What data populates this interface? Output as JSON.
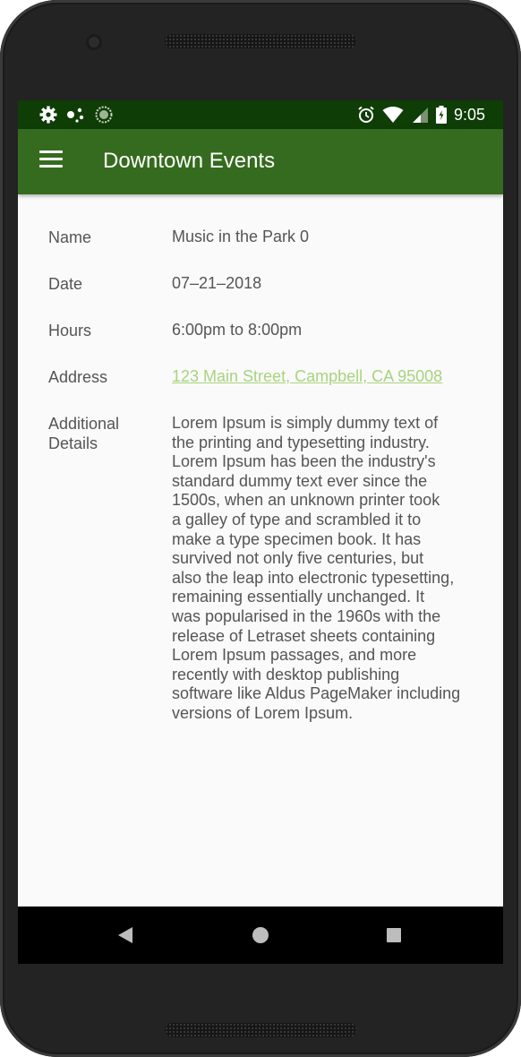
{
  "status_bar": {
    "time": "9:05",
    "icons": [
      "settings-icon",
      "notification-dots-icon",
      "sync-icon",
      "alarm-icon",
      "wifi-icon",
      "signal-icon",
      "battery-icon"
    ]
  },
  "app_bar": {
    "title": "Downtown Events",
    "menu_icon": "hamburger-menu-icon"
  },
  "details": {
    "name_label": "Name",
    "name_value": "Music in the Park 0",
    "date_label": "Date",
    "date_value": "07–21–2018",
    "hours_label": "Hours",
    "hours_value": "6:00pm to 8:00pm",
    "address_label": "Address",
    "address_value": "123 Main Street, Campbell, CA 95008",
    "additional_label_line1": "Additional",
    "additional_label_line2": "Details",
    "additional_lines": [
      "Lorem Ipsum is simply dummy text of",
      "the printing and typesetting industry.",
      "Lorem Ipsum has been the industry's",
      "standard dummy text ever since the",
      "1500s, when an unknown printer took",
      "a galley of type and scrambled it to",
      "make a type specimen book. It has",
      "survived not only five centuries, but",
      "also the leap into electronic typesetting,",
      "remaining essentially unchanged. It",
      "was popularised in the 1960s with the",
      "release of Letraset sheets containing",
      "Lorem Ipsum passages, and more",
      "recently with desktop publishing",
      "software like Aldus PageMaker including",
      "versions of Lorem Ipsum."
    ]
  },
  "nav_bar": {
    "icons": [
      "back-icon",
      "home-icon",
      "recents-icon"
    ]
  },
  "colors": {
    "status_bar": "#0f3d06",
    "app_bar": "#356b1e",
    "link": "#a7d47d",
    "text": "#555555",
    "background": "#fafafa"
  }
}
